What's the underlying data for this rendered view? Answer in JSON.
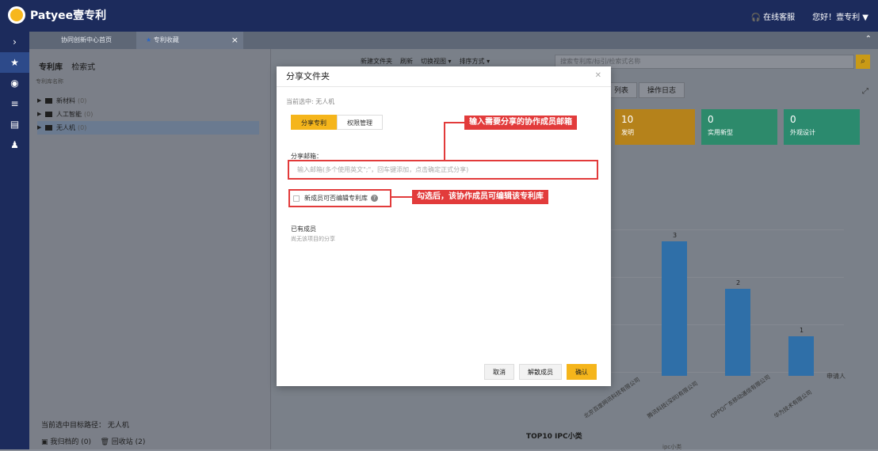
{
  "header": {
    "brand": "Patyee壹专利",
    "support_label": "在线客服",
    "greeting": "您好！壹专利 ▼"
  },
  "tabs": [
    {
      "label": "协同创新中心首页"
    },
    {
      "label": "专利收藏"
    }
  ],
  "sidebar": {
    "tabs": [
      "专利库",
      "检索式"
    ],
    "col_header": "专利库名称",
    "items": [
      {
        "label": "新材料",
        "count": "(0)"
      },
      {
        "label": "人工智能",
        "count": "(0)"
      },
      {
        "label": "无人机",
        "count": "(0)"
      }
    ],
    "path_label": "当前选中目标路径：  无人机",
    "archived": "我归档的 (0)",
    "recycle": "回收站 (2)"
  },
  "toolbar": {
    "new_folder": "新建文件夹",
    "refresh": "刷新",
    "switch_view": "切换视图 ▾",
    "sort": "排序方式 ▾",
    "search_placeholder": "搜索专利库/标引/检索式名称"
  },
  "right_tabs": [
    "列表",
    "操作日志"
  ],
  "cards": [
    {
      "value": "10",
      "label": "发明"
    },
    {
      "value": "0",
      "label": "实用新型"
    },
    {
      "value": "0",
      "label": "外观设计"
    }
  ],
  "chart_data": {
    "type": "bar",
    "categories": [
      "北京百度网讯科技有限公司",
      "腾讯科技(深圳)有限公司",
      "OPPO广东移动通信有限公司",
      "华为技术有限公司"
    ],
    "values": [
      0,
      3,
      2,
      1
    ],
    "xlabel": "申请人",
    "data_labels": [
      "3",
      "2",
      "1"
    ]
  },
  "chart2": {
    "title": "TOP10 IPC小类",
    "xlabel": "ipc小类"
  },
  "dialog": {
    "title": "分享文件夹",
    "current": "当前选中: 无人机",
    "tab_share": "分享专利",
    "tab_perm": "权限管理",
    "email_label": "分享邮箱：",
    "email_placeholder": "输入邮箱(多个使用英文\";\"，回车键添加，点击确定正式分享)",
    "checkbox_label": "新成员可否编辑专利库",
    "members_title": "已有成员",
    "members_empty": "尚无该项目的分享",
    "cancel": "取消",
    "dismiss": "解散成员",
    "confirm": "确认"
  },
  "callouts": {
    "email": "输入需要分享的协作成员邮箱",
    "check": "勾选后，该协作成员可编辑该专利库"
  },
  "colors": {
    "accent": "#f5b51b",
    "callout": "#e23b3b",
    "nav": "#1c2b5c",
    "bar": "#2f6fa8"
  }
}
